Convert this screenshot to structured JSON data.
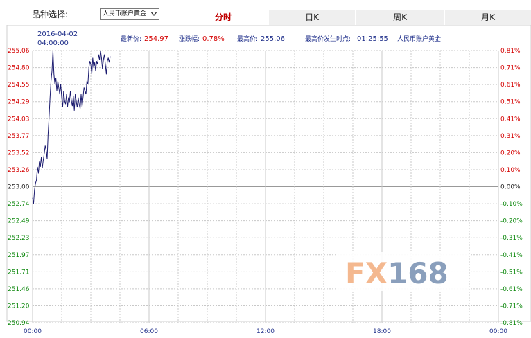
{
  "selector": {
    "label": "品种选择:",
    "value": "人民币账户黄金"
  },
  "tabs": [
    {
      "label": "分时",
      "active": true
    },
    {
      "label": "日K",
      "active": false
    },
    {
      "label": "周K",
      "active": false
    },
    {
      "label": "月K",
      "active": false
    }
  ],
  "info": {
    "date": "2016-04-02",
    "time": "04:00:00",
    "latest_label": "最新价:",
    "latest_value": "254.97",
    "change_label": "涨跌幅:",
    "change_value": "0.78%",
    "high_label": "最高价:",
    "high_value": "255.06",
    "high_time_label": "最高价发生时点:",
    "high_time_value": "01:25:55",
    "product": "人民币账户黄金"
  },
  "watermark": {
    "text": "FX168",
    "colors": {
      "fx": "#f4b88f",
      "num": "#8a9fbc"
    }
  },
  "colors": {
    "line": "#1a1a6e",
    "up": "#d40000",
    "down": "#118a11",
    "neutral": "#222222",
    "grid": "#c8c8c8"
  },
  "chart_data": {
    "type": "line",
    "x_ticks": [
      "00:00",
      "06:00",
      "12:00",
      "18:00",
      "00:00"
    ],
    "y_left_ticks": [
      "255.06",
      "254.80",
      "254.55",
      "254.29",
      "254.03",
      "253.77",
      "253.52",
      "253.26",
      "253.00",
      "252.74",
      "252.49",
      "252.23",
      "251.97",
      "251.71",
      "251.46",
      "251.20",
      "250.94"
    ],
    "y_right_ticks": [
      "0.81%",
      "0.71%",
      "0.61%",
      "0.51%",
      "0.41%",
      "0.31%",
      "0.20%",
      "0.10%",
      "0.00%",
      "-0.10%",
      "-0.20%",
      "-0.31%",
      "-0.41%",
      "-0.51%",
      "-0.61%",
      "-0.71%",
      "-0.81%"
    ],
    "ylim": [
      250.94,
      255.06
    ],
    "base": 253.0,
    "x_hours_range": [
      0,
      24
    ],
    "series": [
      {
        "x": [
          0.0,
          0.05,
          0.1,
          0.15,
          0.2,
          0.25,
          0.3,
          0.35,
          0.4,
          0.45,
          0.5,
          0.55,
          0.6,
          0.65,
          0.7,
          0.75,
          0.8,
          0.85,
          0.9,
          0.95,
          1.0,
          1.05,
          1.1,
          1.15,
          1.2,
          1.25,
          1.3,
          1.35,
          1.4,
          1.45,
          1.5,
          1.55,
          1.6,
          1.65,
          1.7,
          1.75,
          1.8,
          1.85,
          1.9,
          1.95,
          2.0,
          2.05,
          2.1,
          2.15,
          2.2,
          2.25,
          2.3,
          2.35,
          2.4,
          2.45,
          2.5,
          2.55,
          2.6,
          2.65,
          2.7,
          2.75,
          2.8,
          2.85,
          2.9,
          2.95,
          3.0,
          3.05,
          3.1,
          3.15,
          3.2,
          3.25,
          3.3,
          3.35,
          3.4,
          3.45,
          3.5,
          3.55,
          3.6,
          3.65,
          3.7,
          3.75,
          3.8,
          3.85,
          3.9,
          3.95,
          4.0
        ],
        "y": [
          252.83,
          252.74,
          252.95,
          253.05,
          253.1,
          253.3,
          253.2,
          253.38,
          253.3,
          253.45,
          253.28,
          253.4,
          253.5,
          253.62,
          253.55,
          253.42,
          253.8,
          254.05,
          254.35,
          254.6,
          254.75,
          255.06,
          254.7,
          254.55,
          254.65,
          254.45,
          254.6,
          254.5,
          254.4,
          254.55,
          254.35,
          254.2,
          254.45,
          254.3,
          254.25,
          254.4,
          254.2,
          254.35,
          254.28,
          254.45,
          254.3,
          254.22,
          254.38,
          254.15,
          254.4,
          254.3,
          254.2,
          254.35,
          254.25,
          254.18,
          254.4,
          254.2,
          254.35,
          254.5,
          254.45,
          254.4,
          254.6,
          254.55,
          254.8,
          254.9,
          254.85,
          254.7,
          254.95,
          254.8,
          254.88,
          254.75,
          254.9,
          254.85,
          255.0,
          254.92,
          255.06,
          254.95,
          254.78,
          254.92,
          255.0,
          254.85,
          254.7,
          254.9,
          254.95,
          254.88,
          254.97
        ]
      }
    ]
  }
}
